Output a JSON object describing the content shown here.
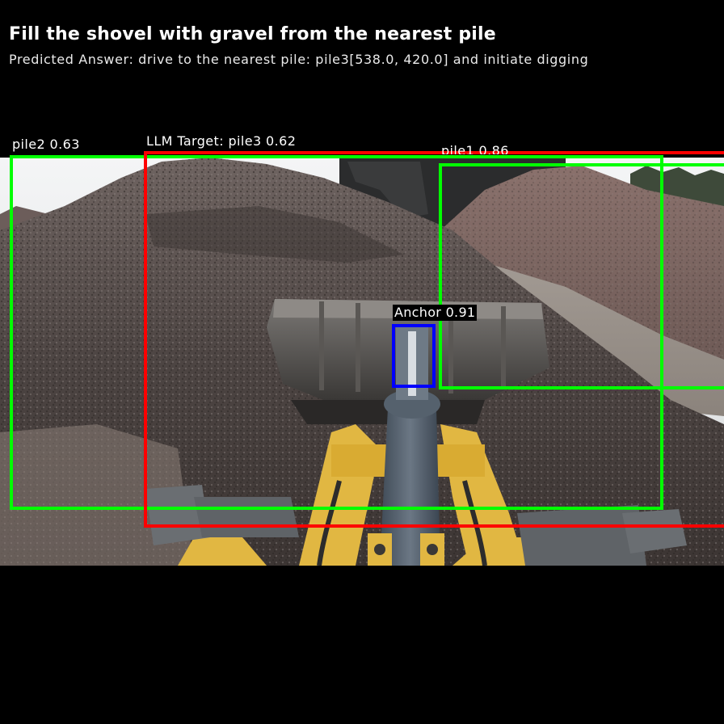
{
  "header": {
    "title": "Fill the shovel with gravel from the nearest pile",
    "answer": "Predicted Answer: drive to the nearest pile: pile3[538.0, 420.0] and initiate digging"
  },
  "detections": {
    "pile2": {
      "label": "pile2 0.63",
      "color": "#00ff00"
    },
    "pile3": {
      "label": "LLM Target: pile3 0.62",
      "color": "#ff0000"
    },
    "pile1": {
      "label": "pile1 0.86",
      "color": "#00ff00"
    },
    "anchor": {
      "label": "Anchor 0.91",
      "color": "#0000ff"
    }
  },
  "scene": {
    "description_icon": "wheel-loader-camera-view"
  }
}
